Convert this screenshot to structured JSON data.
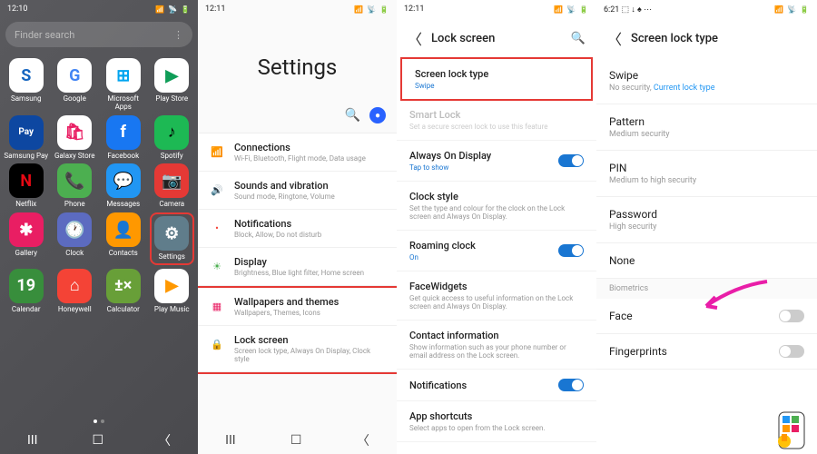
{
  "panel1": {
    "time": "12:10",
    "status_icons": "📶 📡 🔋",
    "search_placeholder": "Finder search",
    "apps": [
      {
        "label": "Samsung",
        "bg": "#fff",
        "fg": "#1565c0",
        "glyph": "S"
      },
      {
        "label": "Google",
        "bg": "#fff",
        "fg": "#4285f4",
        "glyph": "G"
      },
      {
        "label": "Microsoft Apps",
        "bg": "#fff",
        "fg": "#00a4ef",
        "glyph": "⊞"
      },
      {
        "label": "Play Store",
        "bg": "#fff",
        "fg": "#0f9d58",
        "glyph": "▶"
      },
      {
        "label": "Samsung Pay",
        "bg": "#0d47a1",
        "fg": "#fff",
        "glyph": "Pay"
      },
      {
        "label": "Galaxy Store",
        "bg": "#fff",
        "fg": "#e91e63",
        "glyph": "🛍"
      },
      {
        "label": "Facebook",
        "bg": "#1877f2",
        "fg": "#fff",
        "glyph": "f"
      },
      {
        "label": "Spotify",
        "bg": "#1db954",
        "fg": "#000",
        "glyph": "♪"
      },
      {
        "label": "Netflix",
        "bg": "#000",
        "fg": "#e50914",
        "glyph": "N"
      },
      {
        "label": "Phone",
        "bg": "#4caf50",
        "fg": "#fff",
        "glyph": "📞"
      },
      {
        "label": "Messages",
        "bg": "#2196f3",
        "fg": "#fff",
        "glyph": "💬"
      },
      {
        "label": "Camera",
        "bg": "#e53935",
        "fg": "#fff",
        "glyph": "📷"
      },
      {
        "label": "Gallery",
        "bg": "#e91e63",
        "fg": "#fff",
        "glyph": "✱"
      },
      {
        "label": "Clock",
        "bg": "#5c6bc0",
        "fg": "#fff",
        "glyph": "🕐"
      },
      {
        "label": "Contacts",
        "bg": "#ff9800",
        "fg": "#fff",
        "glyph": "👤"
      },
      {
        "label": "Settings",
        "bg": "#607d8b",
        "fg": "#fff",
        "glyph": "⚙",
        "highlight": true
      },
      {
        "label": "Calendar",
        "bg": "#388e3c",
        "fg": "#fff",
        "glyph": "19"
      },
      {
        "label": "Honeywell",
        "bg": "#f44336",
        "fg": "#fff",
        "glyph": "⌂"
      },
      {
        "label": "Calculator",
        "bg": "#689f38",
        "fg": "#fff",
        "glyph": "±×"
      },
      {
        "label": "Play Music",
        "bg": "#fff",
        "fg": "#ff9800",
        "glyph": "▶"
      }
    ]
  },
  "panel2": {
    "time": "12:11",
    "title": "Settings",
    "items": [
      {
        "title": "Connections",
        "sub": "Wi-Fi, Bluetooth, Flight mode, Data usage",
        "icon": "📶",
        "color": "#2196f3"
      },
      {
        "title": "Sounds and vibration",
        "sub": "Sound mode, Ringtone, Volume",
        "icon": "🔊",
        "color": "#ff9800"
      },
      {
        "title": "Notifications",
        "sub": "Block, Allow, Do not disturb",
        "icon": "•",
        "color": "#f44336"
      },
      {
        "title": "Display",
        "sub": "Brightness, Blue light filter, Home screen",
        "icon": "☀",
        "color": "#4caf50"
      },
      {
        "title": "Wallpapers and themes",
        "sub": "Wallpapers, Themes, Icons",
        "icon": "▦",
        "color": "#e91e63"
      },
      {
        "title": "Lock screen",
        "sub": "Screen lock type, Always On Display, Clock style",
        "icon": "🔒",
        "color": "#9c27b0"
      }
    ]
  },
  "panel3": {
    "time": "12:11",
    "header": "Lock screen",
    "items": [
      {
        "title": "Screen lock type",
        "sub": "Swipe",
        "subBlue": true,
        "box": true
      },
      {
        "title": "Smart Lock",
        "sub": "Set a secure screen lock to use this feature",
        "faded": true
      },
      {
        "title": "Always On Display",
        "sub": "Tap to show",
        "subBlue": true,
        "toggle": "on"
      },
      {
        "title": "Clock style",
        "sub": "Set the type and colour for the clock on the Lock screen and Always On Display."
      },
      {
        "title": "Roaming clock",
        "sub": "On",
        "subBlue": true,
        "toggle": "on"
      },
      {
        "title": "FaceWidgets",
        "sub": "Get quick access to useful information on the Lock screen and Always On Display."
      },
      {
        "title": "Contact information",
        "sub": "Show information such as your phone number or email address on the Lock screen."
      },
      {
        "title": "Notifications",
        "toggle": "on"
      },
      {
        "title": "App shortcuts",
        "sub": "Select apps to open from the Lock screen."
      }
    ]
  },
  "panel4": {
    "time": "6:21",
    "status_icons2": "⬚ ↓ ♠ ⋯",
    "header": "Screen lock type",
    "items": [
      {
        "title": "Swipe",
        "sub": "No security, ",
        "link": "Current lock type"
      },
      {
        "title": "Pattern",
        "sub": "Medium security"
      },
      {
        "title": "PIN",
        "sub": "Medium to high security"
      },
      {
        "title": "Password",
        "sub": "High security"
      },
      {
        "title": "None"
      }
    ],
    "biometrics_label": "Biometrics",
    "biometrics": [
      {
        "title": "Face"
      },
      {
        "title": "Fingerprints"
      }
    ]
  }
}
